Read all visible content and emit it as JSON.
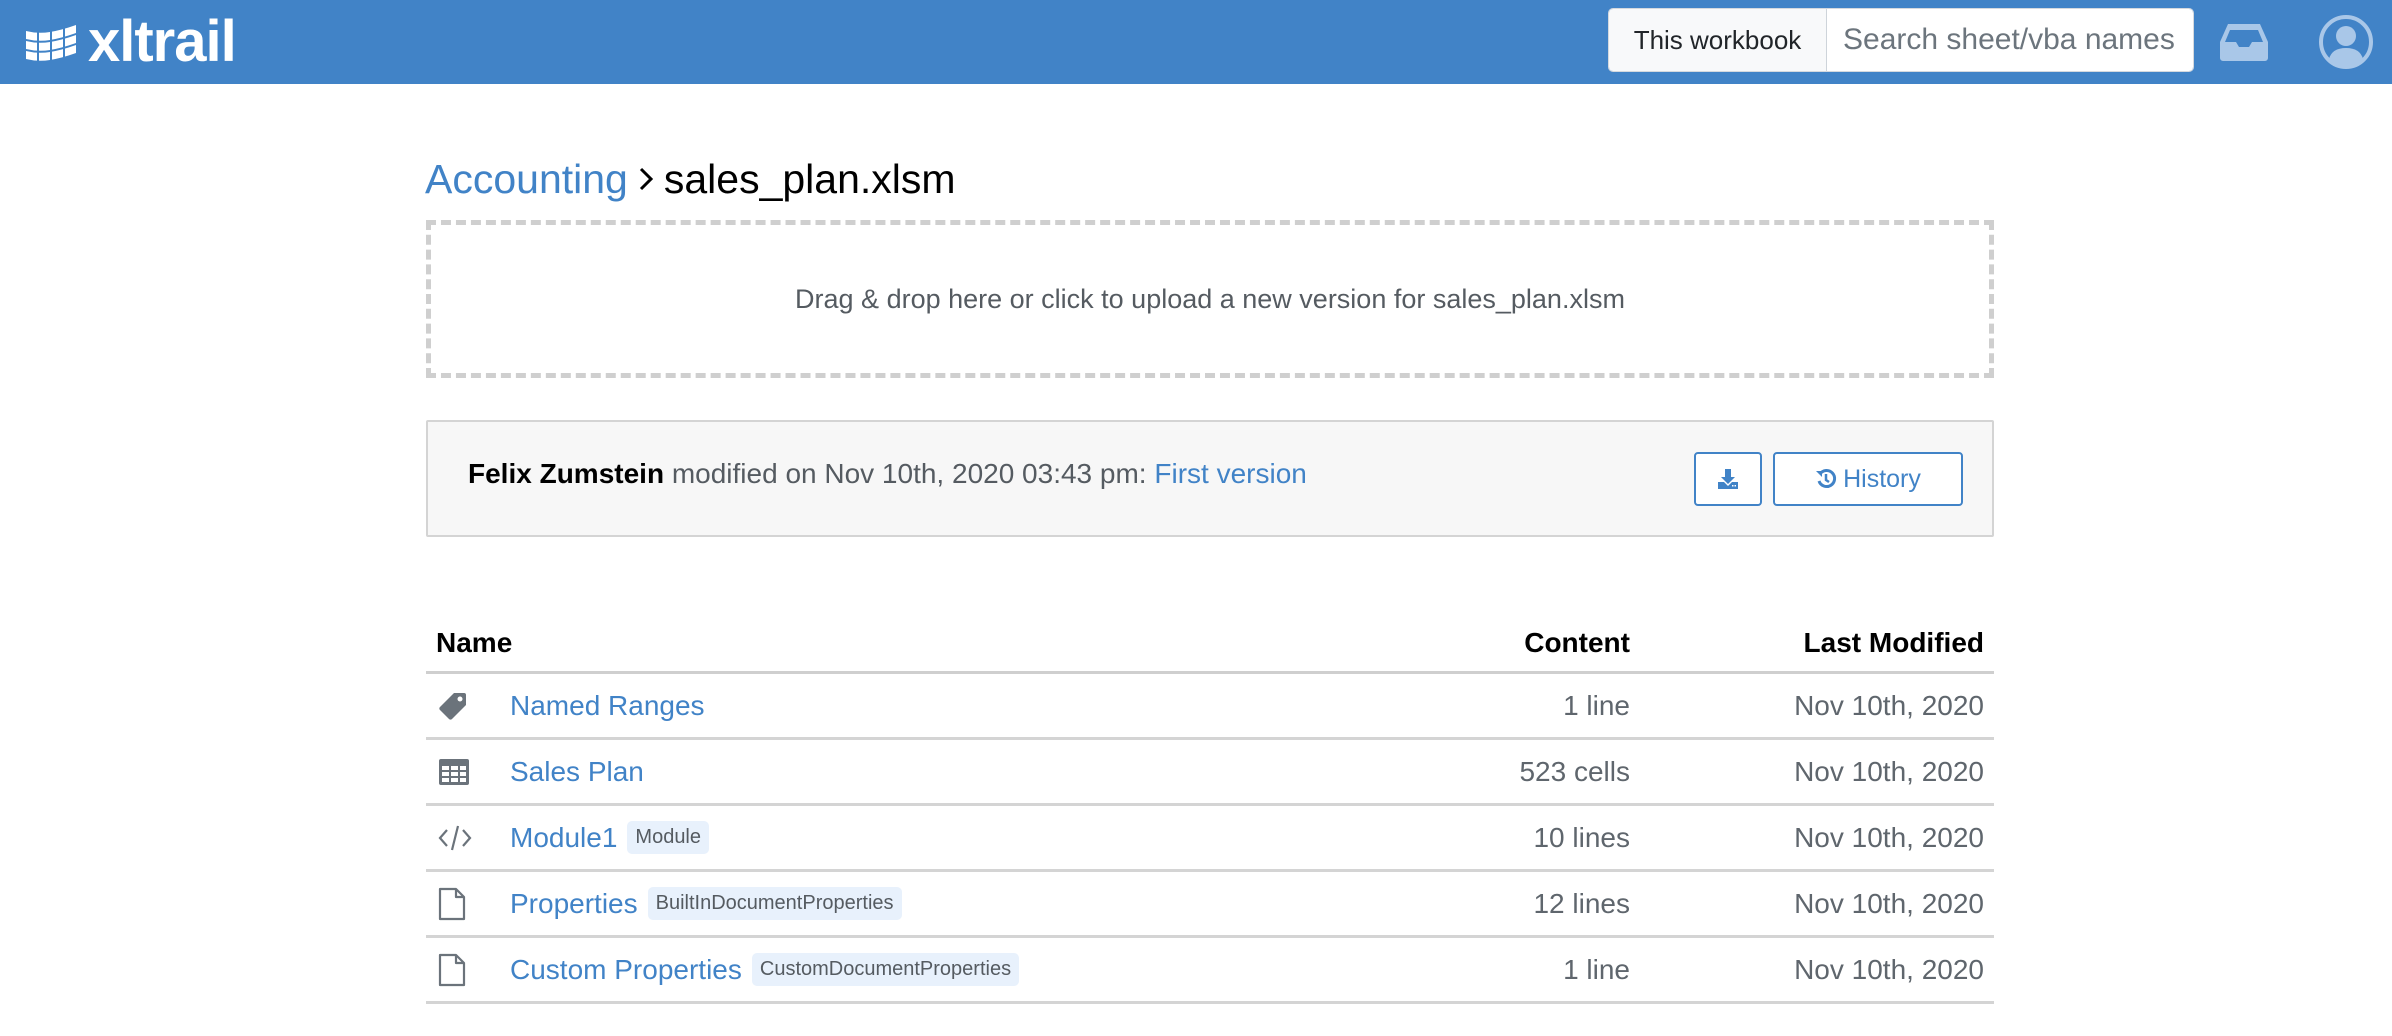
{
  "app": {
    "name": "xltrail",
    "brand_color": "#4183c7"
  },
  "header": {
    "scope_button": "This workbook",
    "search_placeholder": "Search sheet/vba names",
    "search_value": "",
    "icons": [
      "inbox-icon",
      "user-avatar-icon"
    ]
  },
  "breadcrumb": {
    "parent": "Accounting",
    "separator": ">",
    "current": "sales_plan.xlsm"
  },
  "dropzone": {
    "text": "Drag & drop here or click to upload a new version for sales_plan.xlsm"
  },
  "version_info": {
    "author": "Felix Zumstein",
    "action_text": " modified on Nov 10th, 2020 03:43 pm: ",
    "commit_message": "First version",
    "download_icon": "download-icon",
    "history_label": "History",
    "history_icon": "history-icon"
  },
  "table": {
    "columns": [
      "Name",
      "Content",
      "Last Modified"
    ],
    "rows": [
      {
        "icon": "tag-icon",
        "name": "Named Ranges",
        "badge": "",
        "content": "1 line",
        "last_modified": "Nov 10th, 2020"
      },
      {
        "icon": "table-icon",
        "name": "Sales Plan",
        "badge": "",
        "content": "523 cells",
        "last_modified": "Nov 10th, 2020"
      },
      {
        "icon": "code-icon",
        "name": "Module1",
        "badge": "Module",
        "content": "10 lines",
        "last_modified": "Nov 10th, 2020"
      },
      {
        "icon": "file-icon",
        "name": "Properties",
        "badge": "BuiltInDocumentProperties",
        "content": "12 lines",
        "last_modified": "Nov 10th, 2020"
      },
      {
        "icon": "file-icon",
        "name": "Custom Properties",
        "badge": "CustomDocumentProperties",
        "content": "1 line",
        "last_modified": "Nov 10th, 2020"
      }
    ]
  }
}
